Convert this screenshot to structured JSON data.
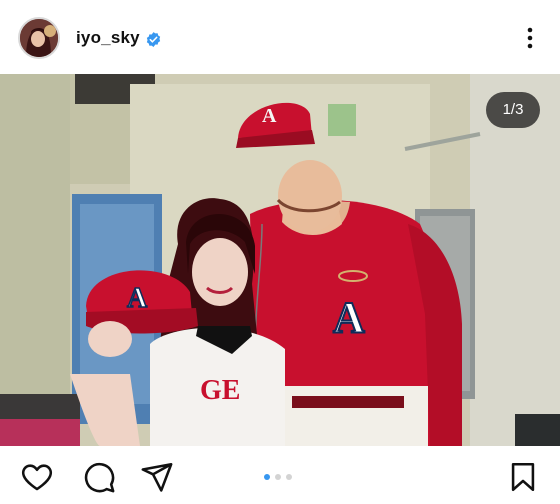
{
  "post": {
    "username": "iyo_sky",
    "verified": true,
    "slide_counter": "1/3",
    "slide_count": 3,
    "active_slide": 1
  },
  "photo": {
    "jersey_text_woman": "GE",
    "cap_logo": "A"
  },
  "icons": {
    "avatar": "profile-avatar",
    "verified": "verified-badge-icon",
    "more": "more-options-icon",
    "like": "heart-icon",
    "comment": "comment-icon",
    "share": "send-icon",
    "save": "bookmark-icon"
  },
  "colors": {
    "verified_blue": "#3797f0",
    "angels_red": "#c8102e",
    "dot_active": "#3797f0",
    "dot_inactive": "#d3d3d3"
  }
}
